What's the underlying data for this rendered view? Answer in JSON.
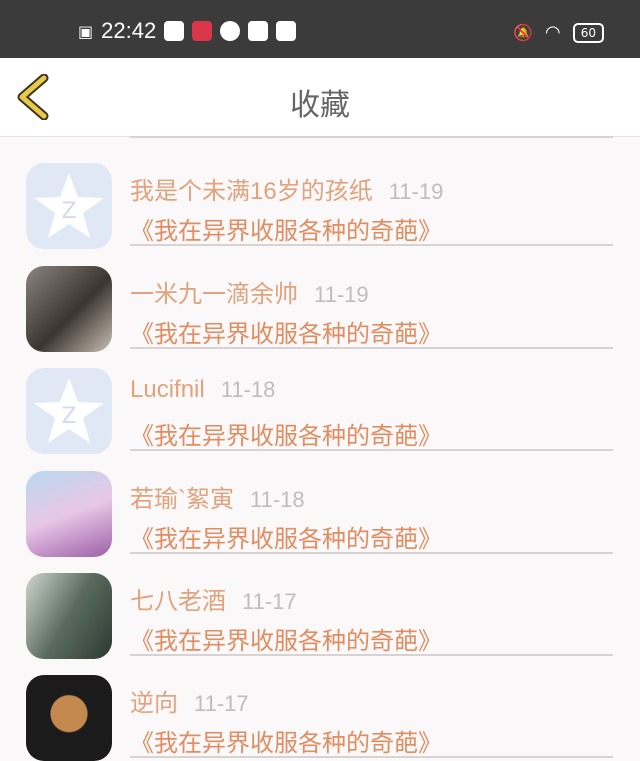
{
  "status_bar": {
    "time": "22:42",
    "battery": "60"
  },
  "header": {
    "title": "收藏"
  },
  "items": [
    {
      "name": "我是个未满16岁的孩纸",
      "date": "11-19",
      "book": "《我在异界收服各种的奇葩》",
      "avatar": "qzone-star-icon"
    },
    {
      "name": "一米九一滴余帅",
      "date": "11-19",
      "book": "《我在异界收服各种的奇葩》",
      "avatar": "photo-avatar"
    },
    {
      "name": "Lucifnil",
      "date": "11-18",
      "book": "《我在异界收服各种的奇葩》",
      "avatar": "qzone-star-icon"
    },
    {
      "name": "若瑜`絮寅",
      "date": "11-18",
      "book": "《我在异界收服各种的奇葩》",
      "avatar": "anime-avatar"
    },
    {
      "name": "七八老酒",
      "date": "11-17",
      "book": "《我在异界收服各种的奇葩》",
      "avatar": "photo-avatar"
    },
    {
      "name": "逆向",
      "date": "11-17",
      "book": "《我在异界收服各种的奇葩》",
      "avatar": "figure-avatar"
    }
  ]
}
